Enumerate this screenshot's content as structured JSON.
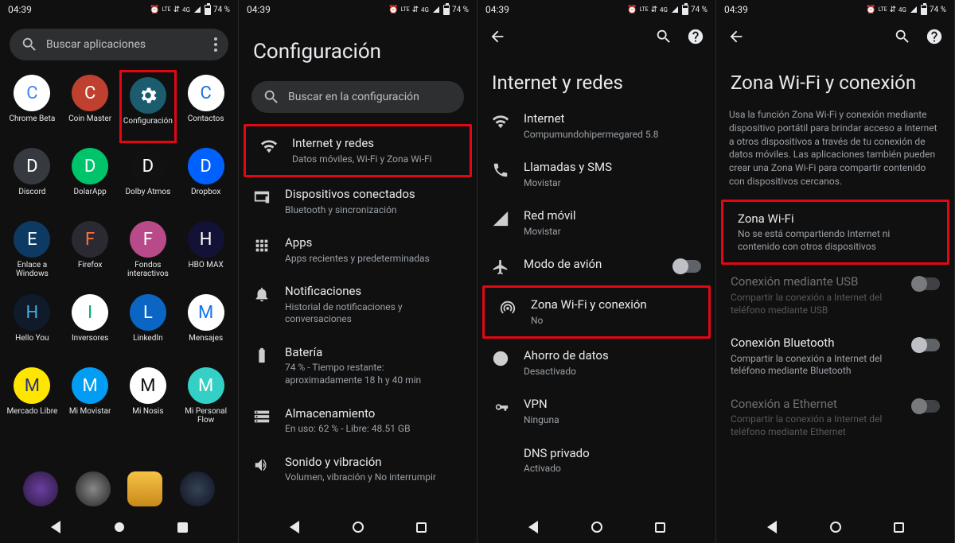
{
  "status": {
    "time": "04:39",
    "battery_pct": "74 %",
    "net_label": "4G",
    "lte_label": "LTE"
  },
  "panel1": {
    "search_placeholder": "Buscar aplicaciones",
    "apps": [
      {
        "label": "Chrome Beta",
        "bg": "#fff",
        "fg": "#4285f4"
      },
      {
        "label": "Coin Master",
        "bg": "#c04030",
        "fg": "#fff"
      },
      {
        "label": "Configuración",
        "bg": "#1b5c6e",
        "fg": "#fff",
        "highlight": true
      },
      {
        "label": "Contactos",
        "bg": "#fff",
        "fg": "#1a73e8"
      },
      {
        "label": "Discord",
        "bg": "#36393f",
        "fg": "#fff"
      },
      {
        "label": "DolarApp",
        "bg": "#00c46a",
        "fg": "#fff"
      },
      {
        "label": "Dolby Atmos",
        "bg": "#111",
        "fg": "#fff"
      },
      {
        "label": "Dropbox",
        "bg": "#0061ff",
        "fg": "#fff"
      },
      {
        "label": "Enlace a Windows",
        "bg": "#0c3a63",
        "fg": "#fff"
      },
      {
        "label": "Firefox",
        "bg": "#2b2a33",
        "fg": "#ff7139"
      },
      {
        "label": "Fondos interactivos",
        "bg": "#b84a8a",
        "fg": "#fff"
      },
      {
        "label": "HBO MAX",
        "bg": "#121236",
        "fg": "#fff"
      },
      {
        "label": "Hello You",
        "bg": "#0f1a2b",
        "fg": "#4ad"
      },
      {
        "label": "Inversores",
        "bg": "#fff",
        "fg": "#0a7"
      },
      {
        "label": "LinkedIn",
        "bg": "#0a66c2",
        "fg": "#fff"
      },
      {
        "label": "Mensajes",
        "bg": "#fff",
        "fg": "#1a73e8"
      },
      {
        "label": "Mercado Libre",
        "bg": "#ffe600",
        "fg": "#2d3277"
      },
      {
        "label": "Mi Movistar",
        "bg": "#019df4",
        "fg": "#fff"
      },
      {
        "label": "Mi Nosis",
        "bg": "#fff",
        "fg": "#111"
      },
      {
        "label": "Mi Personal Flow",
        "bg": "#34d0c6",
        "fg": "#fff"
      }
    ]
  },
  "panel2": {
    "title": "Configuración",
    "search_placeholder": "Buscar en la configuración",
    "items": [
      {
        "title": "Internet y redes",
        "sub": "Datos móviles, Wi-Fi y Zona Wi-Fi",
        "highlight": true,
        "icon": "wifi"
      },
      {
        "title": "Dispositivos conectados",
        "sub": "Bluetooth y sincronización",
        "icon": "devices"
      },
      {
        "title": "Apps",
        "sub": "Apps recientes y predeterminadas",
        "icon": "apps"
      },
      {
        "title": "Notificaciones",
        "sub": "Historial de notificaciones y conversaciones",
        "icon": "bell"
      },
      {
        "title": "Batería",
        "sub": "74 % - Tiempo restante: aproximadamente 18 h y 40 min",
        "icon": "battery"
      },
      {
        "title": "Almacenamiento",
        "sub": "En uso: 62 % - Libre: 48.51 GB",
        "icon": "storage"
      },
      {
        "title": "Sonido y vibración",
        "sub": "Volumen, vibración y No interrumpir",
        "icon": "sound"
      }
    ]
  },
  "panel3": {
    "title": "Internet y redes",
    "items": [
      {
        "title": "Internet",
        "sub": "Compumundohipermegared 5.8",
        "icon": "wifi"
      },
      {
        "title": "Llamadas y SMS",
        "sub": "Movistar",
        "icon": "calls"
      },
      {
        "title": "Red móvil",
        "sub": "Movistar",
        "icon": "signal"
      },
      {
        "title": "Modo de avión",
        "icon": "plane",
        "toggle": true
      },
      {
        "title": "Zona Wi-Fi y conexión",
        "sub": "No",
        "icon": "hotspot",
        "highlight": true
      },
      {
        "title": "Ahorro de datos",
        "sub": "Desactivado",
        "icon": "datasaver"
      },
      {
        "title": "VPN",
        "sub": "Ninguna",
        "icon": "vpn"
      },
      {
        "title": "DNS privado",
        "sub": "Activado"
      }
    ]
  },
  "panel4": {
    "title": "Zona Wi-Fi y conexión",
    "description": "Usa la función Zona Wi-Fi y conexión mediante dispositivo portátil para brindar acceso a Internet a otros dispositivos a través de tu conexión de datos móviles. Las aplicaciones también pueden crear una Zona Wi-Fi para compartir contenido con dispositivos cercanos.",
    "items": [
      {
        "title": "Zona Wi-Fi",
        "sub": "No se está compartiendo Internet ni contenido con otros dispositivos",
        "highlight": true
      },
      {
        "title": "Conexión mediante USB",
        "sub": "Compartir la conexión a Internet del teléfono mediante USB",
        "toggle": true,
        "disabled": true
      },
      {
        "title": "Conexión Bluetooth",
        "sub": "Compartir la conexión a Internet del teléfono mediante Bluetooth",
        "toggle": true
      },
      {
        "title": "Conexión a Ethernet",
        "sub": "Compartir la conexión a Internet del teléfono mediante Ethernet",
        "toggle": true,
        "disabled": true
      }
    ]
  }
}
